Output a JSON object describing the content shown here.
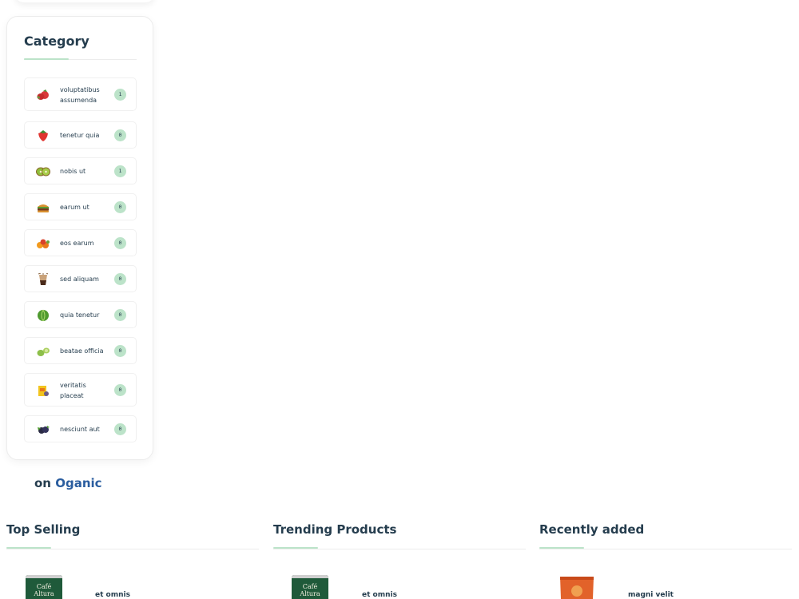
{
  "category_widget": {
    "title": "Category",
    "items": [
      {
        "label": "voluptatibus assumenda",
        "count": "1",
        "icon": "strawberries-icon"
      },
      {
        "label": "tenetur quia",
        "count": "0",
        "icon": "strawberry-icon"
      },
      {
        "label": "nobis ut",
        "count": "1",
        "icon": "kiwi-icon"
      },
      {
        "label": "earum ut",
        "count": "0",
        "icon": "burger-icon"
      },
      {
        "label": "eos earum",
        "count": "0",
        "icon": "fruit-pile-icon"
      },
      {
        "label": "sed aliquam",
        "count": "0",
        "icon": "drink-cup-icon"
      },
      {
        "label": "quia tenetur",
        "count": "0",
        "icon": "cabbage-icon"
      },
      {
        "label": "beatae officia",
        "count": "0",
        "icon": "lime-icon"
      },
      {
        "label": "veritatis placeat",
        "count": "0",
        "icon": "juice-box-icon"
      },
      {
        "label": "nesciunt aut",
        "count": "0",
        "icon": "blackberry-icon"
      }
    ]
  },
  "promo": {
    "prefix": "on",
    "brand": "Oganic"
  },
  "sections": [
    {
      "title": "Top Selling",
      "product_name": "et omnis",
      "thumb": "cafe-altura-can"
    },
    {
      "title": "Trending Products",
      "product_name": "et omnis",
      "thumb": "cafe-altura-can"
    },
    {
      "title": "Recently added",
      "product_name": "magni velit",
      "thumb": "orange-snack-bag"
    }
  ],
  "thumb_text": {
    "line1": "Café",
    "line2": "Altura"
  },
  "colors": {
    "accent": "#bce3c9",
    "heading": "#253d4e",
    "brand": "#2a5d9f"
  }
}
